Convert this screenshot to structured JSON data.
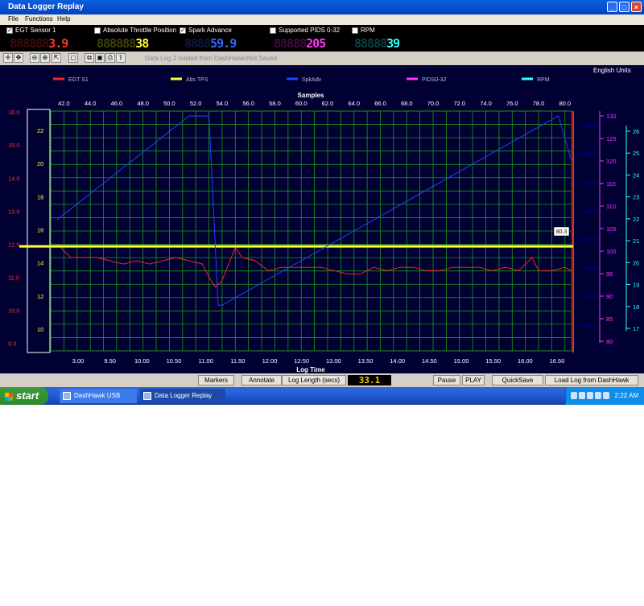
{
  "window": {
    "title": "Data Logger Replay",
    "minimize": "_",
    "maximize": "□",
    "close": "×"
  },
  "menu": {
    "file": "File",
    "functions": "Functions",
    "help": "Help"
  },
  "channels": [
    {
      "label": "EGT Sensor 1",
      "checked": true,
      "digits": "888888",
      "value": "3.9",
      "color": "#ff3030"
    },
    {
      "label": "Absolute Throttle Position",
      "checked": false,
      "digits": "888888",
      "value": "38",
      "color": "#ffff33"
    },
    {
      "label": "Spark Advance",
      "checked": true,
      "digits": "8888",
      "value": "59.9",
      "color": "#3366ff"
    },
    {
      "label": "Supported PIDS 0-32",
      "checked": false,
      "digits": "88888",
      "value": "205",
      "color": "#ff33ff"
    },
    {
      "label": "RPM",
      "checked": false,
      "digits": "88888",
      "value": "39",
      "color": "#33ffff"
    }
  ],
  "toolbar": {
    "status": "Data Log 2 loaded from DashHawk/Not Saved",
    "icons": [
      "crosshair-icon",
      "pan-icon",
      "zoom-out-icon",
      "zoom-in-icon",
      "select-icon",
      "box-icon",
      "copy-icon",
      "save-icon",
      "print-icon",
      "export-icon"
    ]
  },
  "chart_data": {
    "type": "line",
    "units_label": "English Units",
    "top_axis_title": "Samples",
    "bottom_axis_title": "Log Time",
    "top_ticks": [
      "42.0",
      "44.0",
      "46.0",
      "48.0",
      "50.0",
      "52.0",
      "54.0",
      "56.0",
      "58.0",
      "60.0",
      "62.0",
      "64.0",
      "66.0",
      "68.0",
      "70.0",
      "72.0",
      "74.0",
      "76.0",
      "78.0",
      "80.0"
    ],
    "bottom_ticks": [
      "3.00",
      "9.50",
      "10.00",
      "10.50",
      "11.00",
      "11.50",
      "12.00",
      "12:50",
      "13.00",
      "13.50",
      "14.00",
      "14.50",
      "15.00",
      "15.50",
      "16.00",
      "16.50"
    ],
    "left_axis_egt": {
      "ticks": [
        "16.0",
        "15.0",
        "14.0",
        "13.0",
        "12.0",
        "11.0",
        "10.0",
        "9.0"
      ],
      "color": "#ff3030"
    },
    "left_axis_tps": {
      "ticks": [
        "22",
        "20",
        "18",
        "16",
        "14",
        "12",
        "10"
      ],
      "color": "#ffff33"
    },
    "right_axis_spark": {
      "ticks": [
        "130",
        "125",
        "120",
        "115",
        "110",
        "105",
        "100",
        "95",
        "90",
        "85",
        "80"
      ],
      "color": "#ff33ff"
    },
    "right_axis_rpm": {
      "ticks": [
        "26",
        "25",
        "24",
        "23",
        "22",
        "21",
        "20",
        "19",
        "18",
        "17"
      ],
      "color": "#33ffff"
    },
    "cursor_value": "80.3",
    "legend": [
      {
        "name": "EGT S1",
        "color": "#ff2020"
      },
      {
        "name": "Abs TPS",
        "color": "#ffff33"
      },
      {
        "name": "SpkAdv",
        "color": "#2244ff"
      },
      {
        "name": "PIDS0-32",
        "color": "#ff33ff"
      },
      {
        "name": "RPM",
        "color": "#33ffff"
      }
    ],
    "series": [
      {
        "name": "EGT S1",
        "color": "#ff2020",
        "x": [
          41.5,
          42.5,
          43.5,
          44.5,
          45.5,
          46.5,
          47.5,
          48.5,
          49.5,
          50.5,
          51.5,
          52.5,
          53.0,
          53.5,
          54.0,
          54.5,
          55.0,
          55.5,
          56.5,
          57.5,
          58.5,
          59.5,
          60.5,
          61.5,
          62.5,
          63.5,
          64.5,
          65.5,
          66.5,
          67.5,
          68.5,
          69.5,
          70.5,
          71.5,
          72.5,
          73.5,
          74.5,
          75.5,
          76.5,
          77.0,
          77.5,
          78.0,
          79.0,
          80.0,
          80.5
        ],
        "y": [
          12.0,
          11.6,
          11.6,
          11.6,
          11.5,
          11.4,
          11.5,
          11.4,
          11.5,
          11.6,
          11.5,
          11.4,
          11.0,
          10.7,
          10.9,
          11.4,
          11.9,
          11.6,
          11.5,
          11.2,
          11.3,
          11.3,
          11.3,
          11.3,
          11.2,
          11.1,
          11.1,
          11.3,
          11.2,
          11.3,
          11.3,
          11.2,
          11.2,
          11.3,
          11.3,
          11.3,
          11.2,
          11.3,
          11.2,
          11.4,
          11.6,
          11.2,
          11.2,
          11.3,
          11.2
        ]
      },
      {
        "name": "Abs TPS",
        "color": "#ffff33",
        "x": [
          41.0,
          80.5
        ],
        "y": [
          15.0,
          15.0
        ]
      },
      {
        "name": "SpkAdv",
        "color": "#2244ff",
        "x": [
          41.5,
          51.5,
          53.0,
          53.7,
          54.0,
          79.5,
          80.5
        ],
        "y": [
          107,
          130,
          130,
          88,
          88,
          130,
          120
        ]
      }
    ]
  },
  "bottom": {
    "markers": "Markers",
    "annotate": "Annotate",
    "log_length_label": "Log Length (secs)",
    "log_length_value": "33.1",
    "pause": "Pause",
    "play": "PLAY",
    "quicksave": "QuickSave",
    "load": "Load Log from DashHawk"
  },
  "taskbar": {
    "start": "start",
    "task1": "DashHawk USB Interf...",
    "task2": "Data Logger Replay",
    "clock": "2:22 AM"
  }
}
